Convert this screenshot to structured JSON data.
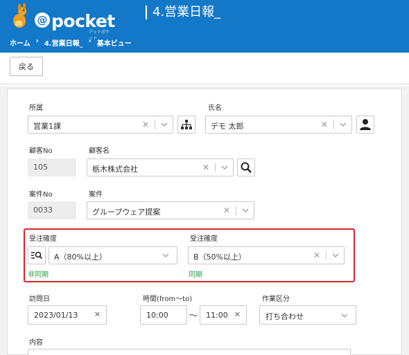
{
  "header": {
    "logo_text": "pocket",
    "logo_at": "@",
    "logo_sub": "アットポケット",
    "title": "4.営業日報_",
    "breadcrumb": [
      "ホーム",
      "›",
      "4.営業日報_",
      "›",
      "基本ビュー"
    ]
  },
  "toolbar": {
    "back_label": "戻る"
  },
  "form": {
    "department": {
      "label": "所属",
      "value": "営業1課"
    },
    "name": {
      "label": "氏名",
      "value": "デモ 太郎"
    },
    "customer_no": {
      "label": "顧客No",
      "value": "105"
    },
    "customer_name": {
      "label": "顧客名",
      "value": "栃木株式会社"
    },
    "case_no": {
      "label": "案件No",
      "value": "0033"
    },
    "case": {
      "label": "案件",
      "value": "グループウェア提案"
    },
    "certainty_left": {
      "label": "受注確度",
      "value": "A（80%以上）",
      "sync_label": "非同期"
    },
    "certainty_right": {
      "label": "受注確度",
      "value": "B（50%以上）",
      "sync_label": "同期"
    },
    "visit_date": {
      "label": "訪問日",
      "value": "2023/01/13"
    },
    "time": {
      "label": "時間(from～to)",
      "from": "10:00",
      "to": "11:00",
      "tilde": "～"
    },
    "work_type": {
      "label": "作業区分",
      "value": "打ち合わせ"
    },
    "content": {
      "label": "内容"
    }
  },
  "colors": {
    "header_bg": "#1478c8",
    "highlight": "#d9232a",
    "green_text": "#2e9a4e"
  }
}
